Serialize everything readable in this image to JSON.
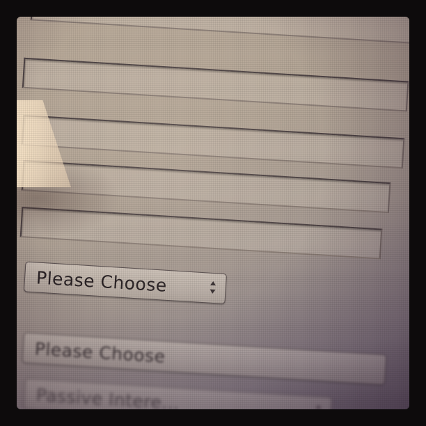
{
  "form": {
    "fields": [
      {
        "value": ""
      },
      {
        "value": ""
      },
      {
        "value": ""
      },
      {
        "value": ""
      },
      {
        "value": ""
      }
    ],
    "select_primary": {
      "label": "Please Choose"
    },
    "select_secondary": {
      "label": "Please Choose"
    },
    "select_tertiary": {
      "label": "Passive Intere..."
    }
  },
  "colors": {
    "screen": "#b3a596",
    "border": "#4e4445",
    "text": "#2a2325",
    "glare": "#f0d7b9"
  },
  "icons": {
    "select_stepper": "up-down-arrows-icon"
  }
}
